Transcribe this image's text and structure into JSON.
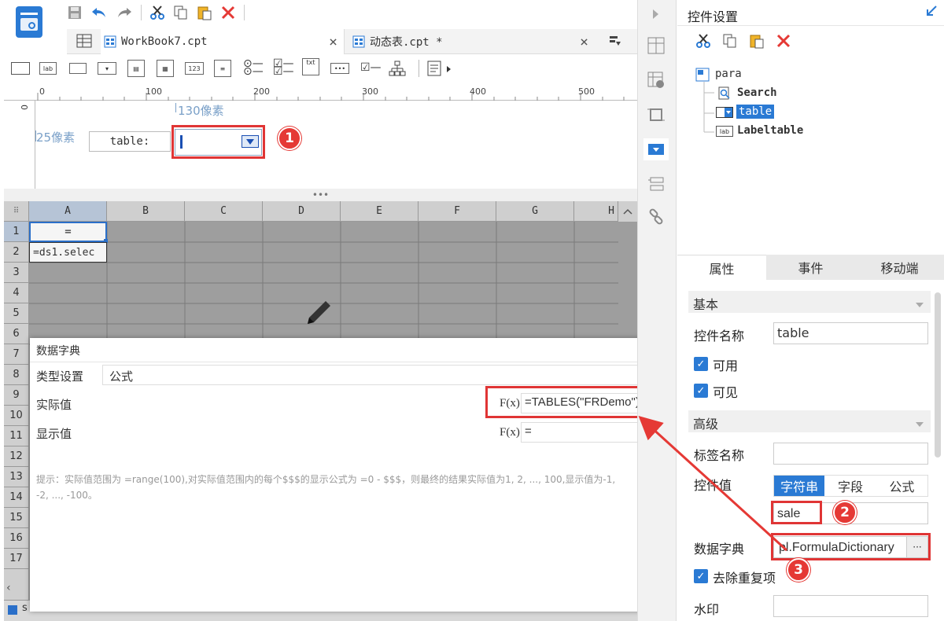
{
  "toolbar": {
    "icons": [
      "save-icon",
      "undo-icon",
      "redo-icon",
      "cut-icon",
      "copy-icon",
      "paste-icon",
      "delete-icon"
    ]
  },
  "tabs": [
    {
      "label": "WorkBook7.cpt",
      "close": "×"
    },
    {
      "label": "动态表.cpt *",
      "close": "×"
    }
  ],
  "controls_bar": {
    "items": [
      "lab",
      "123",
      "txt"
    ]
  },
  "ruler": {
    "marks": [
      "0",
      "100",
      "200",
      "300",
      "400",
      "500"
    ],
    "vmark": "0"
  },
  "param_panel": {
    "width_hint": "130像素",
    "height_hint": "25像素",
    "label_text": "table:"
  },
  "grid": {
    "columns": [
      "A",
      "B",
      "C",
      "D",
      "E",
      "F",
      "G",
      "H"
    ],
    "rows": [
      "1",
      "2",
      "3",
      "4",
      "5",
      "6",
      "7",
      "8",
      "9",
      "10",
      "11",
      "12",
      "13",
      "14",
      "15",
      "16",
      "17"
    ],
    "cells": {
      "a1": "=",
      "a2": "=ds1.selec"
    },
    "status_fragment": "s"
  },
  "dialog": {
    "title": "数据字典",
    "close": "×",
    "type_label": "类型设置",
    "type_value": "公式",
    "actual_label": "实际值",
    "actual_fx": "F(x)",
    "actual_formula": "=TABLES(\"FRDemo\")",
    "display_label": "显示值",
    "display_fx": "F(x)",
    "display_formula": "=",
    "hint": "提示：实际值范围为 =range(100),对实际值范围内的每个$$$的显示公式为 =0 - $$$，则最终的结果实际值为1, 2, ..., 100,显示值为-1, -2, ..., -100。"
  },
  "right_panel": {
    "title": "控件设置",
    "tree": {
      "root": "para",
      "children": [
        "Search",
        "table",
        "Labeltable"
      ],
      "selected": "table"
    },
    "tabs": [
      "属性",
      "事件",
      "移动端"
    ],
    "active_tab": "属性",
    "sections": {
      "basic": "基本",
      "advanced": "高级"
    },
    "widget_name_label": "控件名称",
    "widget_name_value": "table",
    "enabled_label": "可用",
    "visible_label": "可见",
    "tag_name_label": "标签名称",
    "tag_name_value": "",
    "widget_value_label": "控件值",
    "value_types": [
      "字符串",
      "字段",
      "公式"
    ],
    "value_type_selected": "字符串",
    "widget_value": "sale",
    "dict_label": "数据字典",
    "dict_value": "pl.FormulaDictionary",
    "dict_btn": "···",
    "remove_dup_label": "去除重复项",
    "watermark_label": "水印",
    "watermark_value": ""
  },
  "annotations": [
    "1",
    "2",
    "3"
  ],
  "colors": {
    "accent_blue": "#2a7ad4",
    "annotation_red": "#e53935",
    "grid_bg": "#9e9e9e"
  }
}
